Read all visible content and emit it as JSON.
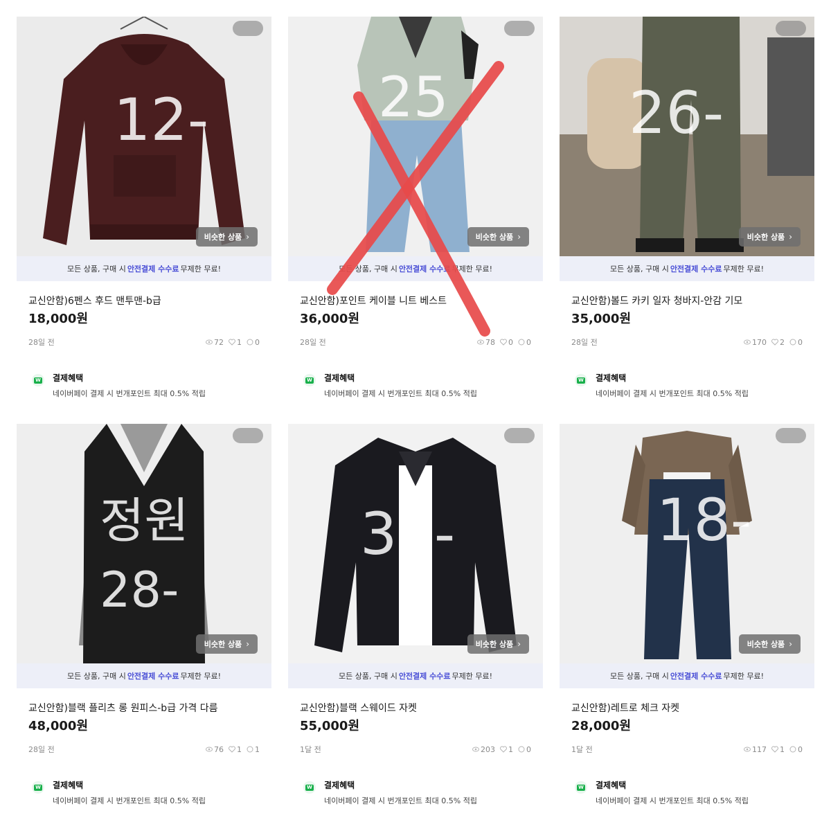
{
  "banner": {
    "prefix": "모든 상품, 구매 시",
    "highlight": "안전결제 수수료",
    "suffix": "무제한 무료!"
  },
  "similar_label": "비슷한 상품",
  "benefit": {
    "title": "결제혜택",
    "desc": "네이버페이 결제 시 번개포인트 최대 0.5% 적립",
    "icon": "naver-pay-icon"
  },
  "products": [
    {
      "title": "교신안함)6펜스 후드 맨투맨-b급",
      "price": "18,000원",
      "age": "28일 전",
      "views": "72",
      "likes": "1",
      "chats": "0",
      "overlay": "12-",
      "garment": "maroon hoodie",
      "colors": {
        "bg": "#eaeaea",
        "main": "#4a1e1f"
      }
    },
    {
      "title": "교신안함)포인트 케이블 니트 베스트",
      "price": "36,000원",
      "age": "28일 전",
      "views": "78",
      "likes": "0",
      "chats": "0",
      "overlay": "25",
      "garment": "cable knit vest",
      "colors": {
        "bg": "#f0f0f0",
        "main": "#b8c4b8"
      }
    },
    {
      "title": "교신안함)볼드 카키 일자 청바지-안감 기모",
      "price": "35,000원",
      "age": "28일 전",
      "views": "170",
      "likes": "2",
      "chats": "0",
      "overlay": "26-",
      "garment": "khaki jeans",
      "colors": {
        "bg": "#8c8172",
        "main": "#5b5f4e"
      }
    },
    {
      "title": "교신안함)블랙 플리츠 롱 원피스-b급 가격 다름",
      "price": "48,000원",
      "age": "28일 전",
      "views": "76",
      "likes": "1",
      "chats": "1",
      "overlay": "정원 28-",
      "garment": "black pleated dress",
      "colors": {
        "bg": "#eeeeee",
        "main": "#1c1c1c"
      }
    },
    {
      "title": "교신안함)블랙 스웨이드 자켓",
      "price": "55,000원",
      "age": "1달 전",
      "views": "203",
      "likes": "1",
      "chats": "0",
      "overlay": "30-",
      "garment": "black suede jacket",
      "colors": {
        "bg": "#f2f2f2",
        "main": "#1a1a1f"
      }
    },
    {
      "title": "교신안함)레트로 체크 자켓",
      "price": "28,000원",
      "age": "1달 전",
      "views": "117",
      "likes": "1",
      "chats": "0",
      "overlay": "18-",
      "garment": "retro check jacket",
      "colors": {
        "bg": "#efefef",
        "main": "#7a6653"
      }
    }
  ]
}
